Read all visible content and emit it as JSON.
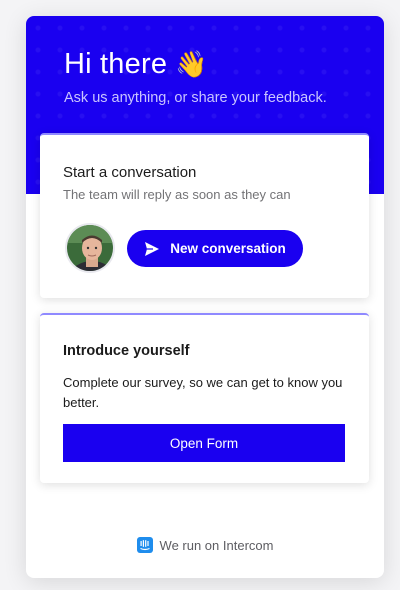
{
  "header": {
    "greeting": "Hi there",
    "wave_emoji": "👋",
    "subtitle": "Ask us anything, or share your feedback."
  },
  "conversation_card": {
    "title": "Start a conversation",
    "subtitle": "The team will reply as soon as they can",
    "button_label": "New conversation",
    "button_icon": "send-icon"
  },
  "intro_card": {
    "title": "Introduce yourself",
    "text": "Complete our survey, so we can get to know you better.",
    "button_label": "Open Form"
  },
  "footer": {
    "text": "We run on Intercom",
    "icon": "intercom-icon"
  },
  "colors": {
    "brand": "#1a00f0",
    "accent_border": "#8f89ff"
  }
}
